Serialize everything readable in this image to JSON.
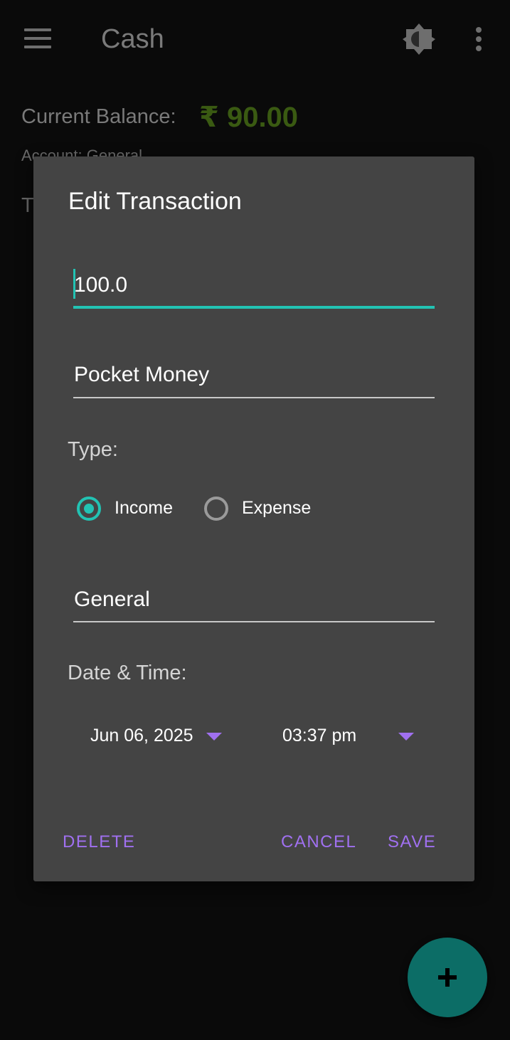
{
  "app_bar": {
    "title": "Cash",
    "menu_icon": "hamburger-menu-icon",
    "theme_icon": "brightness-icon",
    "overflow_icon": "more-vert-icon"
  },
  "summary": {
    "balance_label": "Current Balance:",
    "balance_value": "₹ 90.00",
    "account_label": "Account: General",
    "partial_label": "T"
  },
  "dialog": {
    "title": "Edit Transaction",
    "amount_value": "100.0",
    "description_value": "Pocket Money",
    "type_label": "Type:",
    "type_options": [
      {
        "label": "Income",
        "selected": true
      },
      {
        "label": "Expense",
        "selected": false
      }
    ],
    "account_value": "General",
    "datetime_label": "Date & Time:",
    "date_value": "Jun 06, 2025",
    "time_value": "03:37 pm",
    "actions": {
      "delete": "DELETE",
      "cancel": "CANCEL",
      "save": "SAVE"
    }
  },
  "fab": {
    "icon": "plus-icon"
  },
  "colors": {
    "accent": "#22c3b3",
    "action": "#a070f0",
    "dialog_bg": "#444444",
    "balance_positive": "#3a5a12",
    "fab": "#0c6d66"
  }
}
